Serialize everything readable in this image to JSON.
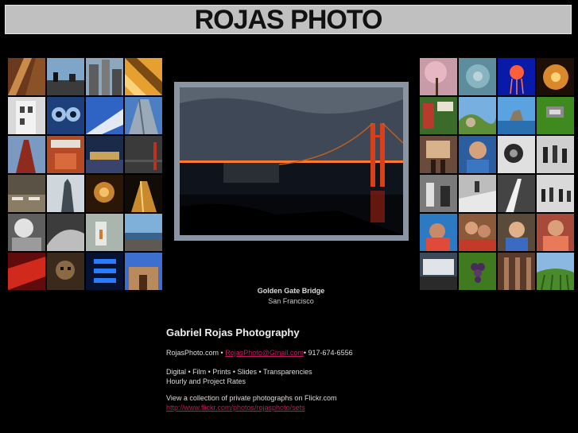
{
  "header": {
    "title": "ROJAS PHOTO"
  },
  "colors": {
    "banner_bg": "#c0c0c0",
    "link": "#c2185b",
    "frame": "#8a95a3"
  },
  "featured": {
    "title": "Golden Gate Bridge",
    "location": "San Francisco"
  },
  "contact": {
    "heading": "Gabriel Rojas Photography",
    "site": "RojasPhoto.com",
    "separator": " • ",
    "email": "RojasPhoto@Gmail.com",
    "phone_prefix": "• ",
    "phone": "917-674-6556",
    "services": "Digital • Film • Prints • Slides • Transparencies",
    "rates": "Hourly and Project Rates",
    "flickr_text": "View a collection of private photographs on Flickr.com",
    "flickr_url": "http://www.flickr.com/photos/rojasphoto/sets"
  }
}
